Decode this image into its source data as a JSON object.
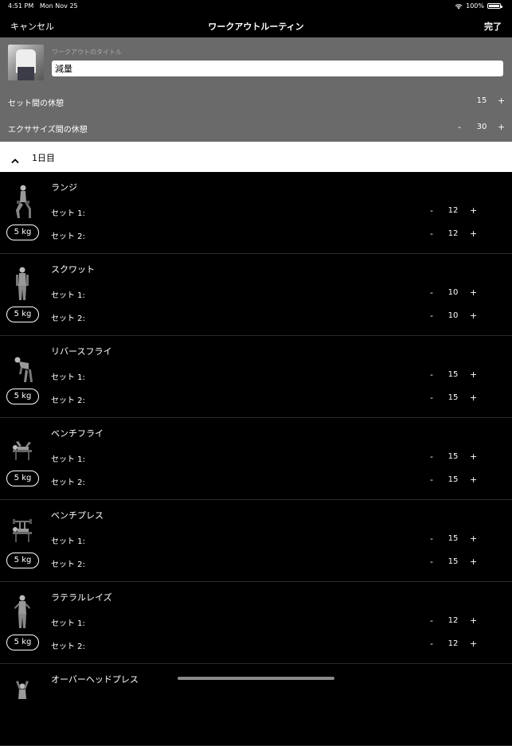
{
  "status": {
    "time": "4:51 PM",
    "date": "Mon Nov 25",
    "battery": "100%",
    "battery_level": 1.0
  },
  "nav": {
    "cancel": "キャンセル",
    "title": "ワークアウトルーティン",
    "done": "完了"
  },
  "settings": {
    "title_label": "ワークアウトのタイトル",
    "title_value": "減量",
    "rest_between_sets": {
      "label": "セット間の休憩",
      "value": "15",
      "plus": "+"
    },
    "rest_between_exercises": {
      "label": "エクササイズ間の休憩",
      "minus": "-",
      "value": "30",
      "plus": "+"
    }
  },
  "day": {
    "label": "1日目"
  },
  "exercises": [
    {
      "name": "ランジ",
      "weight": "5 kg",
      "sets": [
        {
          "label": "セット 1:",
          "value": "12"
        },
        {
          "label": "セット 2:",
          "value": "12"
        }
      ]
    },
    {
      "name": "スクワット",
      "weight": "5 kg",
      "sets": [
        {
          "label": "セット 1:",
          "value": "10"
        },
        {
          "label": "セット 2:",
          "value": "10"
        }
      ]
    },
    {
      "name": "リバースフライ",
      "weight": "5 kg",
      "sets": [
        {
          "label": "セット 1:",
          "value": "15"
        },
        {
          "label": "セット 2:",
          "value": "15"
        }
      ]
    },
    {
      "name": "ベンチフライ",
      "weight": "5 kg",
      "sets": [
        {
          "label": "セット 1:",
          "value": "15"
        },
        {
          "label": "セット 2:",
          "value": "15"
        }
      ]
    },
    {
      "name": "ベンチプレス",
      "weight": "5 kg",
      "sets": [
        {
          "label": "セット 1:",
          "value": "15"
        },
        {
          "label": "セット 2:",
          "value": "15"
        }
      ]
    },
    {
      "name": "ラテラルレイズ",
      "weight": "5 kg",
      "sets": [
        {
          "label": "セット 1:",
          "value": "12"
        },
        {
          "label": "セット 2:",
          "value": "12"
        }
      ]
    },
    {
      "name": "オーバーヘッドプレス"
    }
  ],
  "controls": {
    "minus": "-",
    "plus": "+"
  },
  "icons": {
    "collapse": "chevron-up-icon",
    "wifi": "wifi-icon",
    "battery": "battery-icon"
  }
}
